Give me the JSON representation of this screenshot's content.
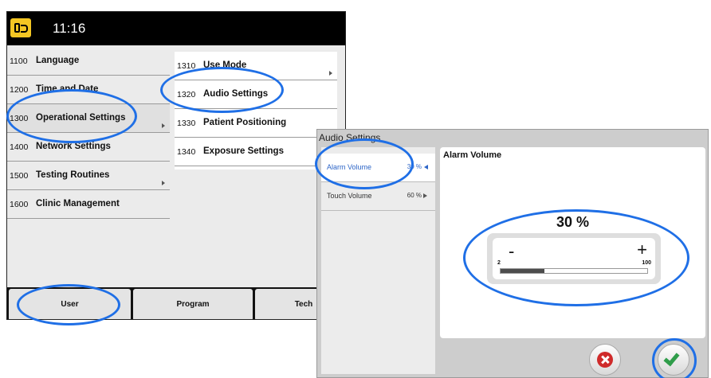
{
  "clock": "11:16",
  "menu": {
    "items": [
      {
        "code": "1100",
        "label": "Language",
        "has_arrow": false
      },
      {
        "code": "1200",
        "label": "Time and Date",
        "has_arrow": false
      },
      {
        "code": "1300",
        "label": "Operational Settings",
        "has_arrow": true
      },
      {
        "code": "1400",
        "label": "Network Settings",
        "has_arrow": false
      },
      {
        "code": "1500",
        "label": "Testing Routines",
        "has_arrow": true
      },
      {
        "code": "1600",
        "label": "Clinic Management",
        "has_arrow": false
      }
    ]
  },
  "submenu": {
    "items": [
      {
        "code": "1310",
        "label": "Use Mode",
        "has_arrow": true
      },
      {
        "code": "1320",
        "label": "Audio Settings",
        "has_arrow": false
      },
      {
        "code": "1330",
        "label": "Patient Positioning",
        "has_arrow": false
      },
      {
        "code": "1340",
        "label": "Exposure Settings",
        "has_arrow": false
      }
    ]
  },
  "bottom_tabs": [
    {
      "label": "User"
    },
    {
      "label": "Program"
    },
    {
      "label": "Tech"
    }
  ],
  "dialog": {
    "title": "Audio Settings",
    "settings": [
      {
        "label": "Alarm Volume",
        "value": "30 %",
        "selected": true
      },
      {
        "label": "Touch Volume",
        "value": "60 %",
        "selected": false
      }
    ],
    "detail": {
      "title": "Alarm Volume",
      "value_text": "30 %",
      "minus": "-",
      "plus": "+",
      "min": "2",
      "max": "100",
      "level_percent": 30
    }
  },
  "colors": {
    "highlight": "#1f6fe6",
    "cancel": "#cf2a2a",
    "confirm": "#2f9d4a",
    "app_icon": "#f3c623"
  },
  "icons": {
    "app": "tooth-hand-icon",
    "cancel": "cancel-icon",
    "confirm": "checkmark-icon"
  }
}
